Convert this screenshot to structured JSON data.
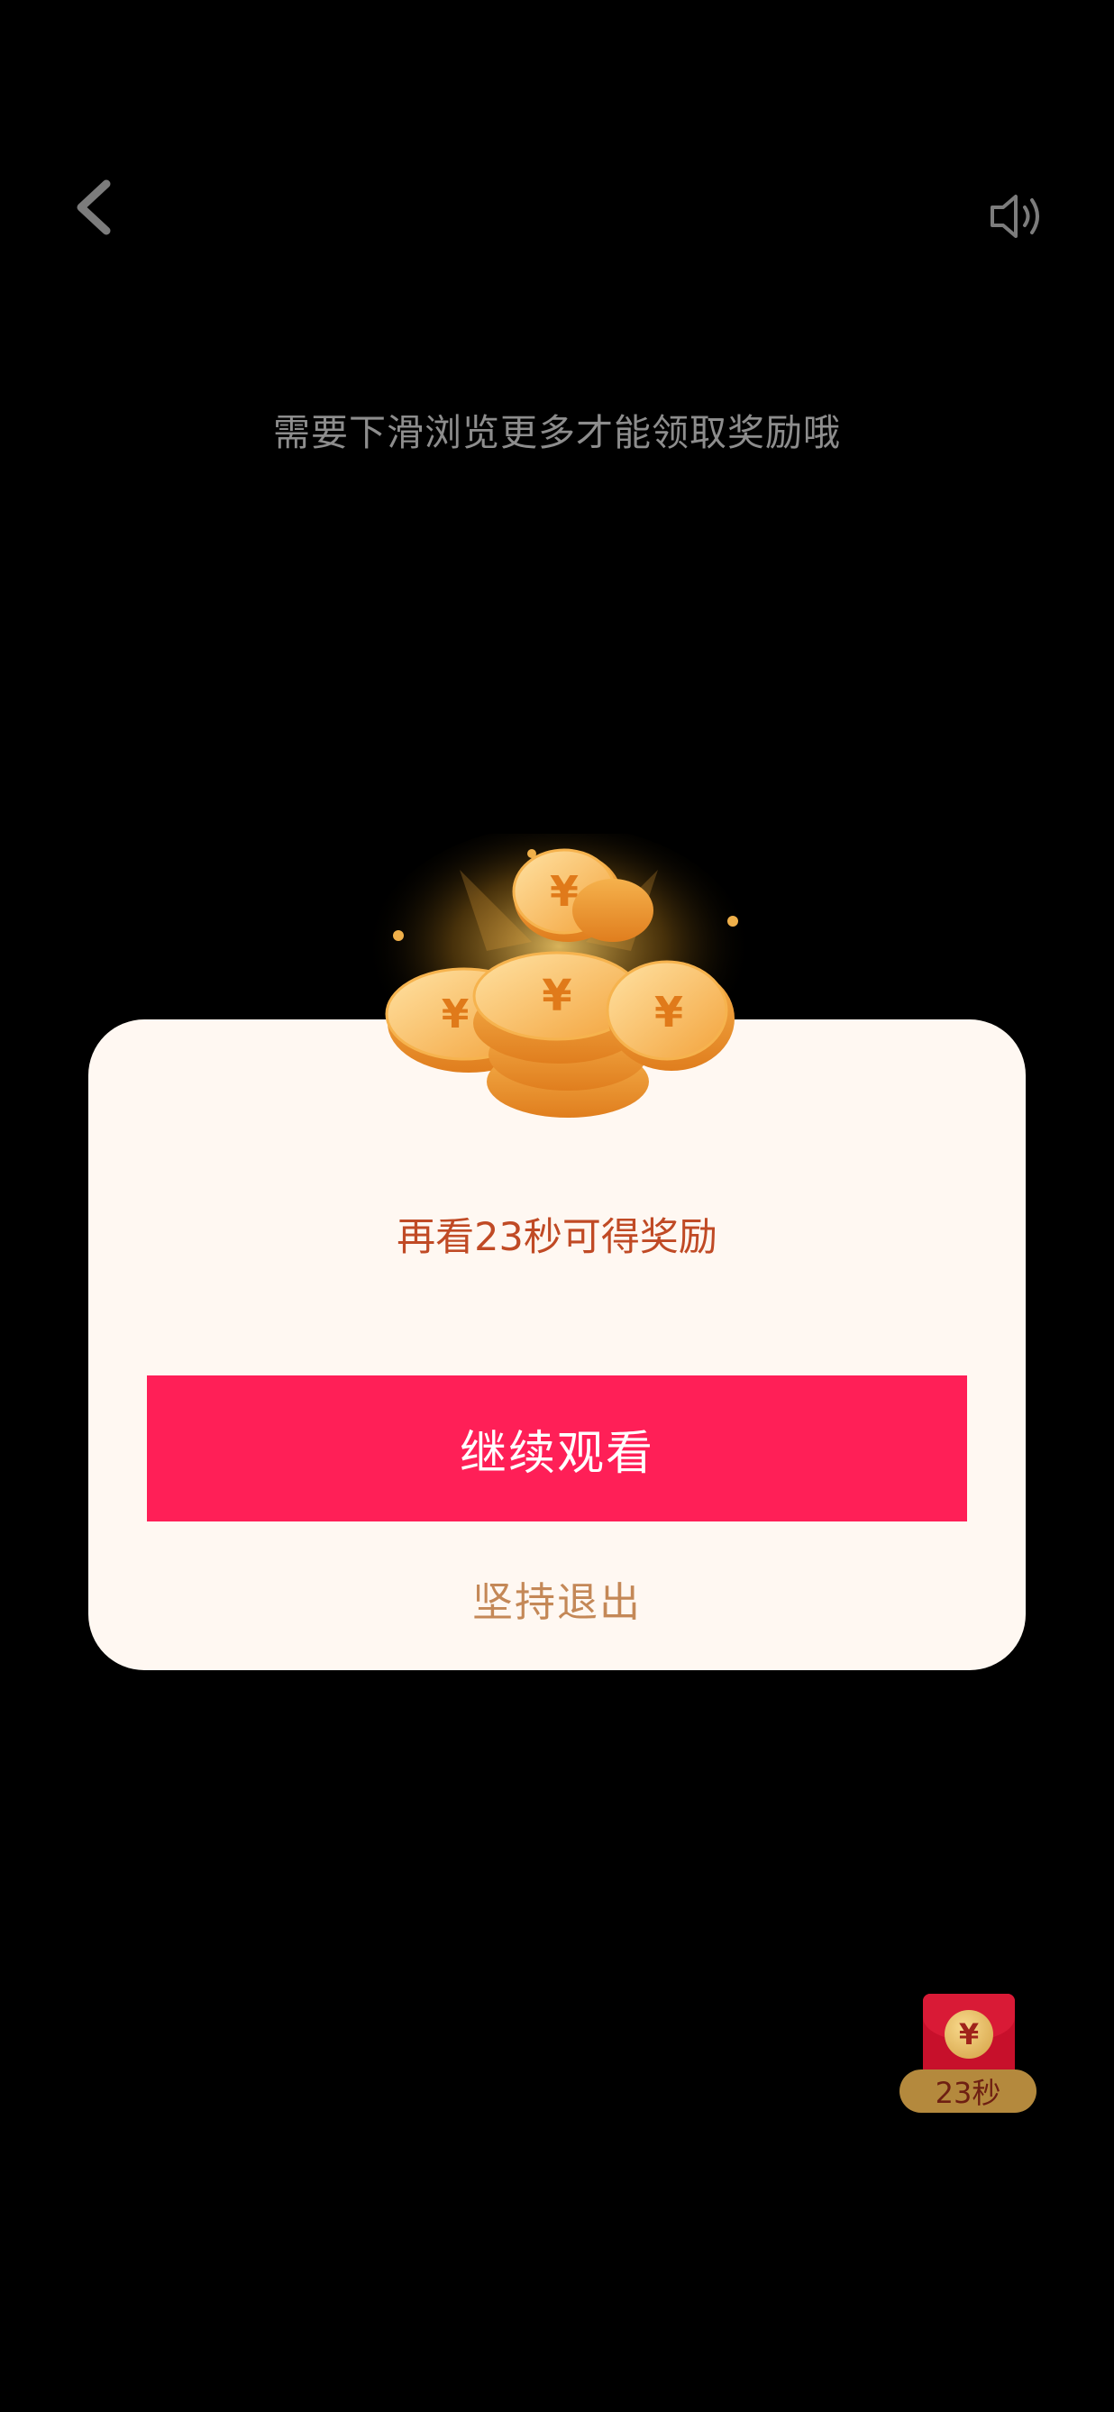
{
  "header": {
    "back_icon": "chevron-left-icon",
    "sound_icon": "speaker-icon"
  },
  "hint_text": "需要下滑浏览更多才能领取奖励哦",
  "dialog": {
    "reward_text": "再看23秒可得奖励",
    "continue_label": "继续观看",
    "exit_label": "坚持退出",
    "coin_symbol": "¥"
  },
  "timer_widget": {
    "coin_symbol": "¥",
    "label": "23秒"
  },
  "colors": {
    "background": "#000000",
    "dialog_bg": "#fff8f2",
    "accent_button": "#ff1f57",
    "reward_text": "#c04a25",
    "exit_text": "#c48857"
  }
}
